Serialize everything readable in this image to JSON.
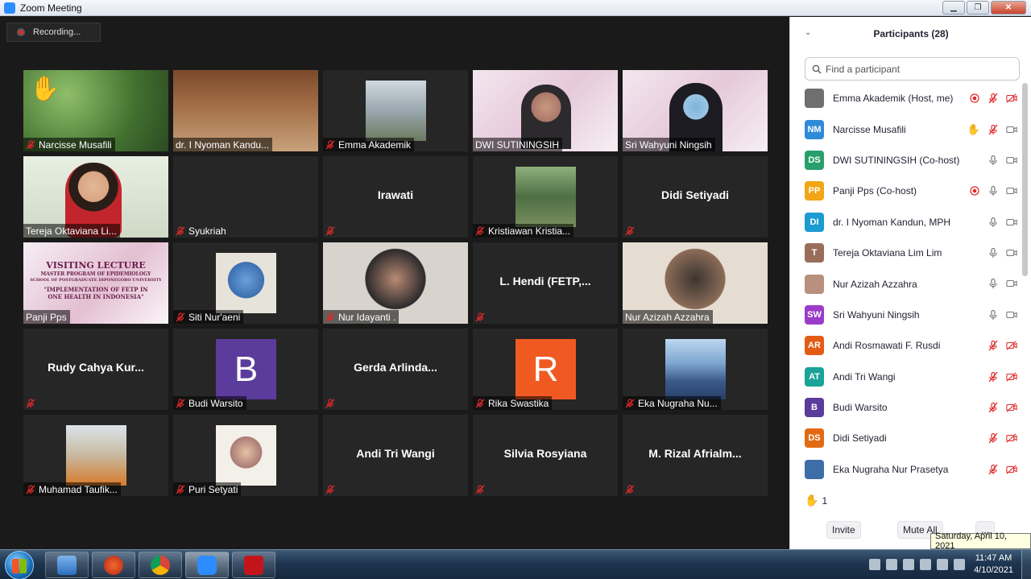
{
  "window": {
    "title": "Zoom Meeting",
    "min_label": "▁",
    "max_label": "❐",
    "close_label": "✕"
  },
  "recording": {
    "label": "Recording..."
  },
  "tiles": [
    {
      "name": "Narcisse Musafili",
      "type": "video"
    },
    {
      "name": "dr. I Nyoman Kandu...",
      "type": "video"
    },
    {
      "name": "Emma Akademik",
      "type": "image"
    },
    {
      "name": "DWI SUTININGSIH",
      "type": "video"
    },
    {
      "name": "Sri Wahyuni Ningsih",
      "type": "video"
    },
    {
      "name": "Tereja Oktaviana Li...",
      "type": "video"
    },
    {
      "name": "Syukriah",
      "type": "blank"
    },
    {
      "big": "Irawati",
      "type": "name-only"
    },
    {
      "name": "Kristiawan Kristia...",
      "type": "image"
    },
    {
      "big": "Didi Setiyadi",
      "type": "name-only"
    },
    {
      "name": "Panji Pps",
      "type": "poster"
    },
    {
      "name": "Siti Nur'aeni",
      "type": "image"
    },
    {
      "name": "Nur Idayanti .",
      "type": "video"
    },
    {
      "big": "L. Hendi (FETP,...",
      "type": "name-only"
    },
    {
      "name": "Nur Azizah Azzahra",
      "type": "video"
    },
    {
      "big": "Rudy Cahya Kur...",
      "type": "name-only"
    },
    {
      "name": "Budi Warsito",
      "type": "letter",
      "letter": "B"
    },
    {
      "big": "Gerda Arlinda...",
      "type": "name-only"
    },
    {
      "name": "Rika Swastika",
      "type": "letter",
      "letter": "R"
    },
    {
      "name": "Eka Nugraha Nu...",
      "type": "image"
    },
    {
      "name": "Muhamad Taufik...",
      "type": "image"
    },
    {
      "name": "Puri Setyati",
      "type": "image"
    },
    {
      "big": "Andi Tri Wangi",
      "type": "name-only"
    },
    {
      "big": "Silvia Rosyiana",
      "type": "name-only"
    },
    {
      "big": "M. Rizal Afrialm...",
      "type": "name-only"
    }
  ],
  "poster": {
    "line1": "VISITING LECTURE",
    "line2": "MASTER PROGRAM OF EPIDEMIOLOGY",
    "line3": "SCHOOL OF POSTGRADUATE DIPONEGORO UNIVERSITY",
    "line4": "\"IMPLEMENTATION OF FETP IN ONE HEALTH IN INDONESIA\""
  },
  "participants": {
    "header": "Participants (28)",
    "search_placeholder": "Find a participant",
    "list": [
      {
        "name": "Emma Akademik (Host, me)",
        "avatar": "",
        "color": "#6f6f6f",
        "status": "record",
        "mic": "muted",
        "video": "off"
      },
      {
        "name": "Narcisse Musafili",
        "avatar": "NM",
        "color": "#2f8bd8",
        "status": "hand",
        "mic": "muted",
        "video": "on"
      },
      {
        "name": "DWI SUTININGSIH (Co-host)",
        "avatar": "DS",
        "color": "#28a06b",
        "status": "",
        "mic": "on",
        "video": "on"
      },
      {
        "name": "Panji Pps (Co-host)",
        "avatar": "PP",
        "color": "#f2a516",
        "status": "record",
        "mic": "on",
        "video": "on"
      },
      {
        "name": "dr. I Nyoman Kandun, MPH",
        "avatar": "DI",
        "color": "#1b9bd1",
        "status": "",
        "mic": "on",
        "video": "on"
      },
      {
        "name": "Tereja Oktaviana Lim Lim",
        "avatar": "T",
        "color": "#9a6d5a",
        "status": "",
        "mic": "on",
        "video": "on"
      },
      {
        "name": "Nur Azizah Azzahra",
        "avatar": "",
        "color": "#b8907d",
        "status": "",
        "mic": "on",
        "video": "on"
      },
      {
        "name": "Sri Wahyuni Ningsih",
        "avatar": "SW",
        "color": "#9b3cc9",
        "status": "",
        "mic": "on",
        "video": "on"
      },
      {
        "name": "Andi Rosmawati F. Rusdi",
        "avatar": "AR",
        "color": "#e35c16",
        "status": "",
        "mic": "muted",
        "video": "off"
      },
      {
        "name": "Andi Tri Wangi",
        "avatar": "AT",
        "color": "#1aa396",
        "status": "",
        "mic": "muted",
        "video": "off"
      },
      {
        "name": "Budi Warsito",
        "avatar": "B",
        "color": "#5b3b9b",
        "status": "",
        "mic": "muted",
        "video": "off"
      },
      {
        "name": "Didi Setiyadi",
        "avatar": "DS",
        "color": "#e36a12",
        "status": "",
        "mic": "muted",
        "video": "off"
      },
      {
        "name": "Eka Nugraha Nur Prasetya",
        "avatar": "",
        "color": "#3e6ea8",
        "status": "",
        "mic": "muted",
        "video": "off"
      }
    ],
    "raised_count": "1",
    "invite_label": "Invite",
    "mute_all_label": "Mute All",
    "more_label": "..."
  },
  "taskbar": {
    "time": "11:47 AM",
    "date": "4/10/2021",
    "tooltip": "Saturday, April 10, 2021"
  },
  "colors": {
    "muted_red": "#e02828",
    "accent_blue": "#2d8cff",
    "active_speaker": "#d4e34d"
  }
}
